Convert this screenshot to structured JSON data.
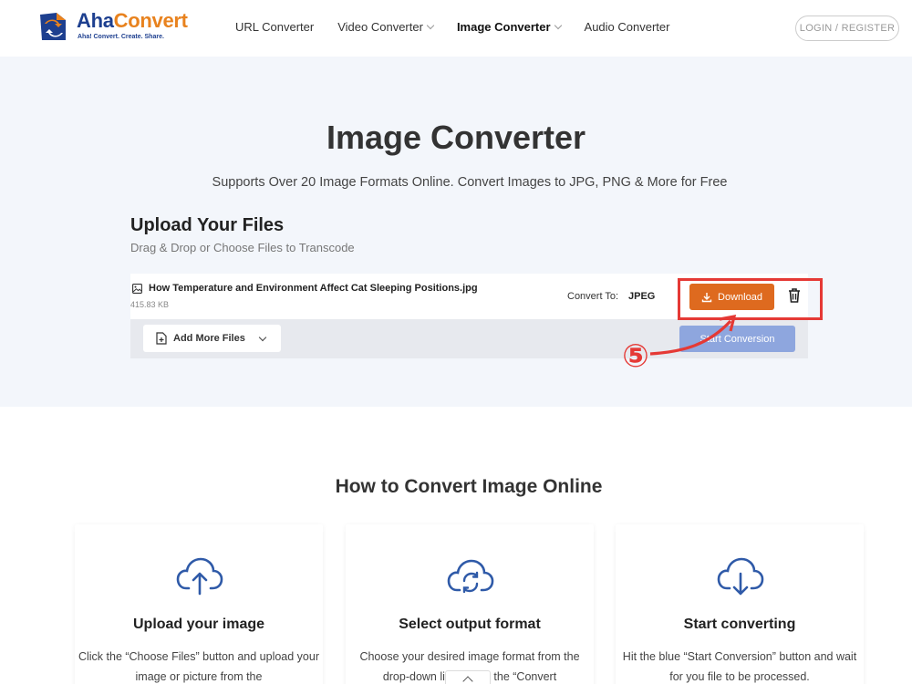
{
  "header": {
    "logo_prefix": "Aha",
    "logo_suffix": "Convert",
    "tagline": "Aha! Convert. Create. Share.",
    "nav": [
      {
        "label": "URL Converter"
      },
      {
        "label": "Video Converter"
      },
      {
        "label": "Image Converter"
      },
      {
        "label": "Audio Converter"
      }
    ],
    "login_label": "LOGIN / REGISTER"
  },
  "hero": {
    "title": "Image Converter",
    "subtitle": "Supports Over 20 Image Formats Online. Convert Images to JPG, PNG & More for Free"
  },
  "upload": {
    "title": "Upload Your Files",
    "subtitle": "Drag & Drop or Choose Files to Transcode",
    "file": {
      "name": "How Temperature and Environment Affect Cat Sleeping Positions.jpg",
      "size": "415.83 KB",
      "convert_label": "Convert To:",
      "convert_value": "JPEG",
      "download_label": "Download"
    },
    "add_more_label": "Add More Files",
    "start_label": "Start Conversion"
  },
  "annotation": {
    "step": "⑤",
    "color": "#e53935"
  },
  "howto": {
    "title": "How to Convert Image Online",
    "cards": [
      {
        "title": "Upload your image",
        "text": "Click the “Choose Files” button and upload your image or picture from the",
        "icon": "cloud-upload-icon"
      },
      {
        "title": "Select output format",
        "text": "Choose your desired image format from the drop-down list beside the “Convert",
        "icon": "cloud-sync-icon"
      },
      {
        "title": "Start converting",
        "text": "Hit the blue “Start Conversion” button and wait for you file to be processed.",
        "icon": "cloud-download-icon"
      }
    ]
  },
  "colors": {
    "brand_blue": "#1d3f8f",
    "brand_orange": "#e8821e",
    "download_orange": "#de6a1f",
    "start_blue": "#8ea6de",
    "icon_blue": "#2f5aa8"
  }
}
